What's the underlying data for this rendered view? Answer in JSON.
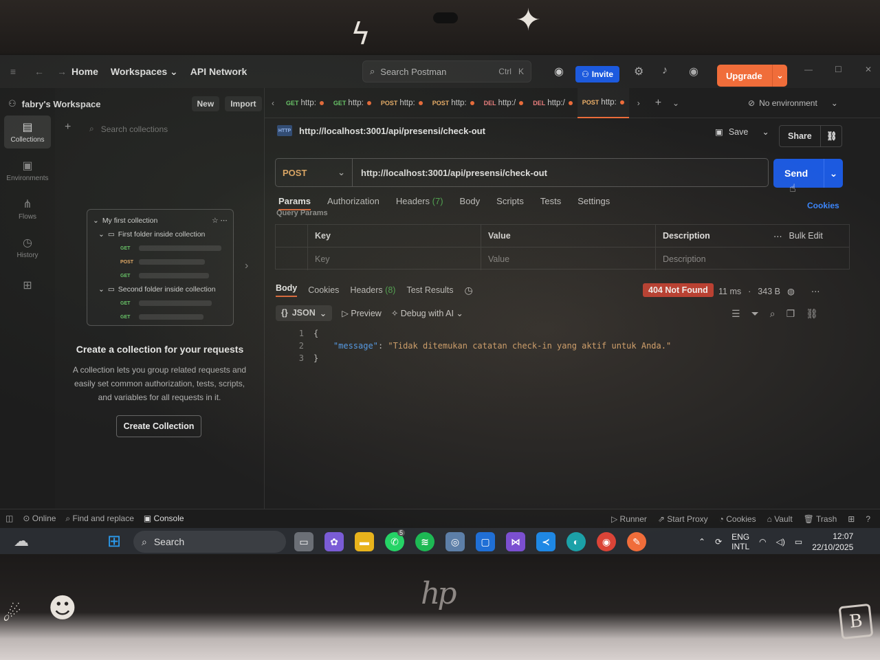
{
  "topbar": {
    "home": "Home",
    "workspaces": "Workspaces",
    "api_network": "API Network",
    "search_placeholder": "Search Postman",
    "search_shortcut_ctrl": "Ctrl",
    "search_shortcut_key": "K",
    "invite": "Invite",
    "upgrade": "Upgrade"
  },
  "workspace": {
    "name": "fabry's Workspace",
    "new": "New",
    "import": "Import",
    "search_collections": "Search collections"
  },
  "rail": [
    {
      "label": "Collections",
      "icon": "collections-icon"
    },
    {
      "label": "Environments",
      "icon": "environments-icon"
    },
    {
      "label": "Flows",
      "icon": "flows-icon"
    },
    {
      "label": "History",
      "icon": "history-icon"
    }
  ],
  "preview": {
    "collection": "My first collection",
    "folder1": "First folder inside collection",
    "folder2": "Second folder inside collection",
    "methods1": [
      "GET",
      "POST",
      "GET"
    ],
    "methods2": [
      "GET",
      "GET"
    ]
  },
  "empty_state": {
    "title": "Create a collection for your requests",
    "description": "A collection lets you group related requests and easily set common authorization, tests, scripts, and variables for all requests in it.",
    "button": "Create Collection"
  },
  "tabs": [
    {
      "method": "GET",
      "label": "http:",
      "color": "#6bcf6b"
    },
    {
      "method": "GET",
      "label": "http:",
      "color": "#6bcf6b"
    },
    {
      "method": "POST",
      "label": "http:",
      "color": "#f2b36a"
    },
    {
      "method": "POST",
      "label": "http:",
      "color": "#f2b36a"
    },
    {
      "method": "DEL",
      "label": "http:/",
      "color": "#f08080"
    },
    {
      "method": "DEL",
      "label": "http:/",
      "color": "#f08080"
    },
    {
      "method": "POST",
      "label": "http:",
      "color": "#f2b36a"
    }
  ],
  "environment": "No environment",
  "request": {
    "title": "http://localhost:3001/api/presensi/check-out",
    "method": "POST",
    "url": "http://localhost:3001/api/presensi/check-out",
    "save": "Save",
    "share": "Share",
    "send": "Send",
    "cookies": "Cookies",
    "tabs": [
      "Params",
      "Authorization",
      "Headers",
      "Body",
      "Scripts",
      "Tests",
      "Settings"
    ],
    "headers_count": "(7)",
    "query_params_label": "Query Params"
  },
  "params_table": {
    "headers": [
      "Key",
      "Value",
      "Description"
    ],
    "bulk_edit": "Bulk Edit",
    "placeholders": [
      "Key",
      "Value",
      "Description"
    ]
  },
  "response": {
    "tabs": [
      "Body",
      "Cookies",
      "Headers",
      "Test Results"
    ],
    "headers_count": "(8)",
    "status": "404 Not Found",
    "time": "11 ms",
    "size": "343 B",
    "format": "JSON",
    "preview": "Preview",
    "debug": "Debug with AI",
    "lines": [
      {
        "n": "1",
        "text": "{"
      },
      {
        "n": "2",
        "key": "\"message\"",
        "sep": ": ",
        "value": "\"Tidak ditemukan catatan check-in yang aktif untuk Anda.\""
      },
      {
        "n": "3",
        "text": "}"
      }
    ]
  },
  "statusbar": {
    "online": "Online",
    "find_replace": "Find and replace",
    "console": "Console",
    "runner": "Runner",
    "start_proxy": "Start Proxy",
    "cookies": "Cookies",
    "vault": "Vault",
    "trash": "Trash"
  },
  "taskbar": {
    "search": "Search",
    "lang1": "ENG",
    "lang2": "INTL",
    "time": "12:07",
    "date": "22/10/2025",
    "whatsapp_badge": "5"
  },
  "colors": {
    "accent": "#f06d3a",
    "primary": "#1c5ae0",
    "error": "#c0392b"
  }
}
